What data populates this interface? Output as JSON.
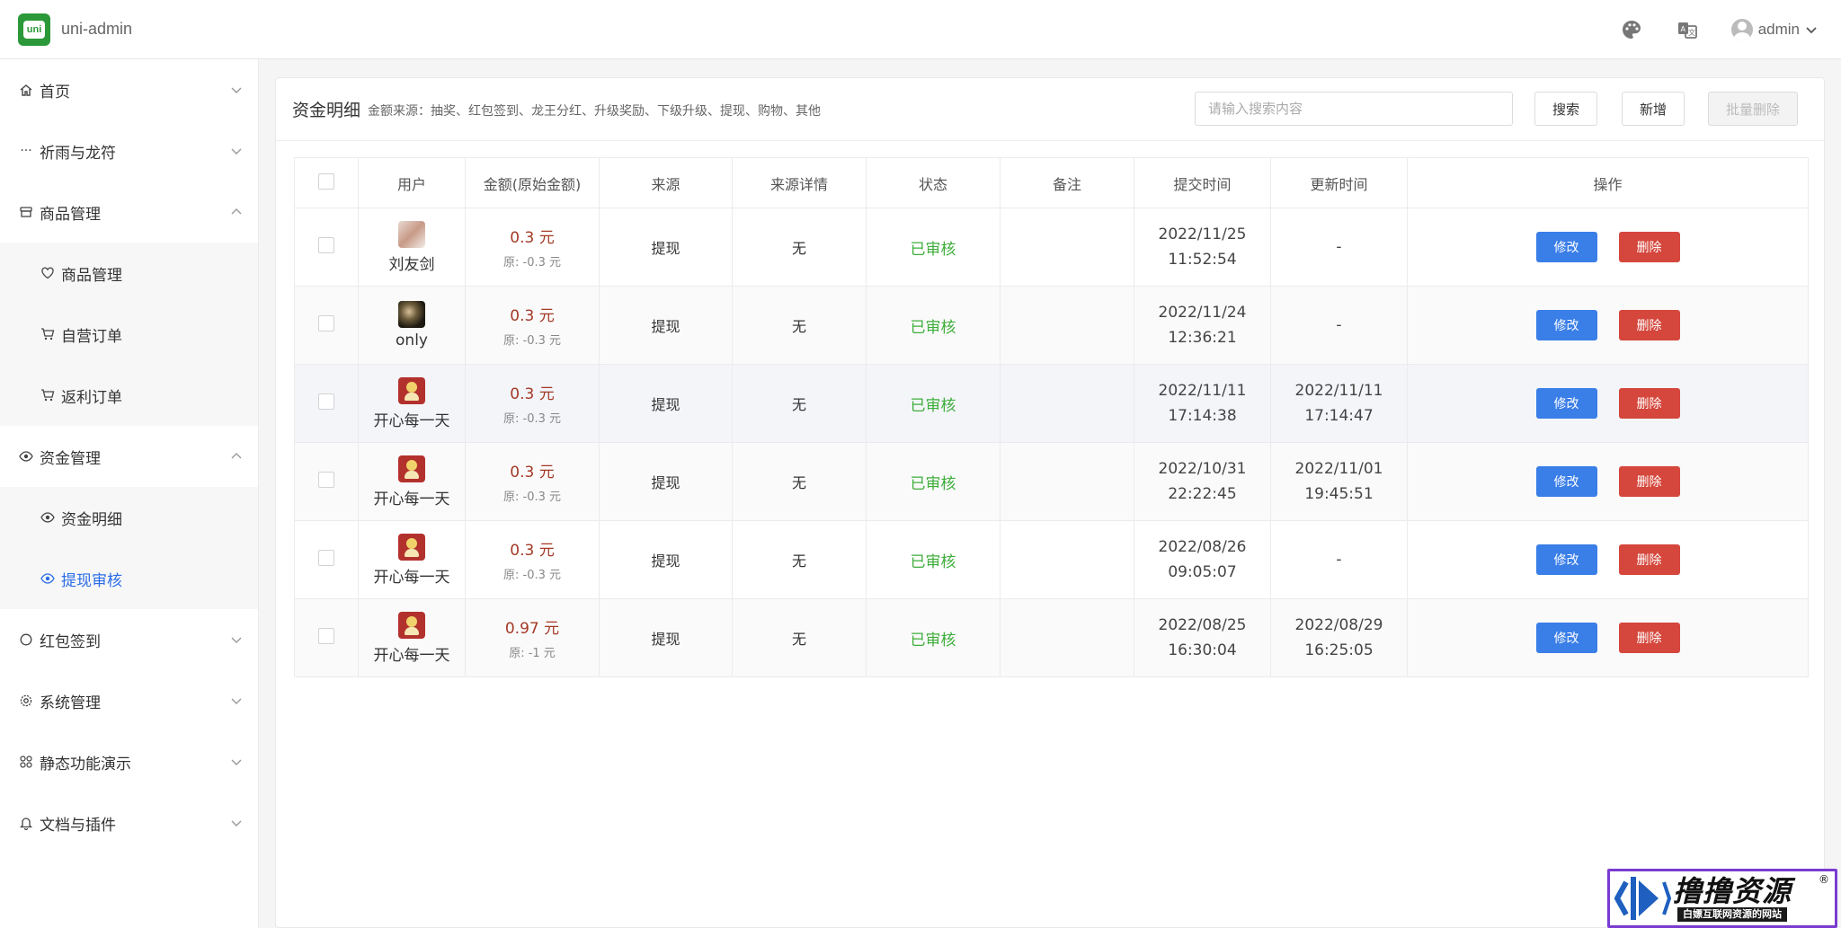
{
  "app": {
    "logo_text": "uni",
    "title": "uni-admin",
    "user": "admin"
  },
  "icons": {
    "theme": "palette-icon",
    "language": "translate-icon",
    "user": "user-avatar-icon"
  },
  "sidebar": {
    "items": [
      {
        "label": "首页",
        "icon": "home-icon"
      },
      {
        "label": "祈雨与龙符",
        "icon": "more-icon"
      },
      {
        "label": "商品管理",
        "icon": "shop-icon",
        "expanded": true,
        "children": [
          {
            "label": "商品管理",
            "icon": "heart-icon"
          },
          {
            "label": "自营订单",
            "icon": "cart-icon"
          },
          {
            "label": "返利订单",
            "icon": "cart-icon"
          }
        ]
      },
      {
        "label": "资金管理",
        "icon": "eye-icon",
        "expanded": true,
        "children": [
          {
            "label": "资金明细",
            "icon": "eye-icon"
          },
          {
            "label": "提现审核",
            "icon": "eye-icon",
            "active": true
          }
        ]
      },
      {
        "label": "红包签到",
        "icon": "circle-icon"
      },
      {
        "label": "系统管理",
        "icon": "gear-icon"
      },
      {
        "label": "静态功能演示",
        "icon": "grid-icon"
      },
      {
        "label": "文档与插件",
        "icon": "bell-icon"
      }
    ]
  },
  "header": {
    "title": "资金明细",
    "subtitle": "金额来源：抽奖、红包签到、龙王分红、升级奖励、下级升级、提现、购物、其他",
    "search_placeholder": "请输入搜索内容",
    "search_label": "搜索",
    "add_label": "新增",
    "batch_delete_label": "批量删除"
  },
  "table": {
    "columns": [
      "用户",
      "金额(原始金额)",
      "来源",
      "来源详情",
      "状态",
      "备注",
      "提交时间",
      "更新时间",
      "操作"
    ],
    "edit_label": "修改",
    "delete_label": "删除",
    "rows": [
      {
        "user": "刘友剑",
        "avatar": "av-a",
        "amount": "0.3 元",
        "original": "原: -0.3 元",
        "source": "提现",
        "detail": "无",
        "status": "已审核",
        "note": "",
        "submit_date": "2022/11/25",
        "submit_time": "11:52:54",
        "update_date": "-",
        "update_time": ""
      },
      {
        "user": "only",
        "avatar": "av-b",
        "amount": "0.3 元",
        "original": "原: -0.3 元",
        "source": "提现",
        "detail": "无",
        "status": "已审核",
        "note": "",
        "submit_date": "2022/11/24",
        "submit_time": "12:36:21",
        "update_date": "-",
        "update_time": ""
      },
      {
        "user": "开心每一天",
        "avatar": "av-c",
        "amount": "0.3 元",
        "original": "原: -0.3 元",
        "source": "提现",
        "detail": "无",
        "status": "已审核",
        "note": "",
        "submit_date": "2022/11/11",
        "submit_time": "17:14:38",
        "update_date": "2022/11/11",
        "update_time": "17:14:47"
      },
      {
        "user": "开心每一天",
        "avatar": "av-c",
        "amount": "0.3 元",
        "original": "原: -0.3 元",
        "source": "提现",
        "detail": "无",
        "status": "已审核",
        "note": "",
        "submit_date": "2022/10/31",
        "submit_time": "22:22:45",
        "update_date": "2022/11/01",
        "update_time": "19:45:51"
      },
      {
        "user": "开心每一天",
        "avatar": "av-c",
        "amount": "0.3 元",
        "original": "原: -0.3 元",
        "source": "提现",
        "detail": "无",
        "status": "已审核",
        "note": "",
        "submit_date": "2022/08/26",
        "submit_time": "09:05:07",
        "update_date": "-",
        "update_time": ""
      },
      {
        "user": "开心每一天",
        "avatar": "av-c",
        "amount": "0.97 元",
        "original": "原: -1 元",
        "source": "提现",
        "detail": "无",
        "status": "已审核",
        "note": "",
        "submit_date": "2022/08/25",
        "submit_time": "16:30:04",
        "update_date": "2022/08/29",
        "update_time": "16:25:05"
      }
    ]
  },
  "watermark": {
    "title": "撸撸资源",
    "subtitle": "白嫖互联网资源的网站",
    "reg": "®"
  },
  "colors": {
    "primary": "#3a7ee8",
    "danger": "#d5473c",
    "success": "#3fae3b",
    "amount": "#a33a26",
    "brand": "#2b9939"
  }
}
